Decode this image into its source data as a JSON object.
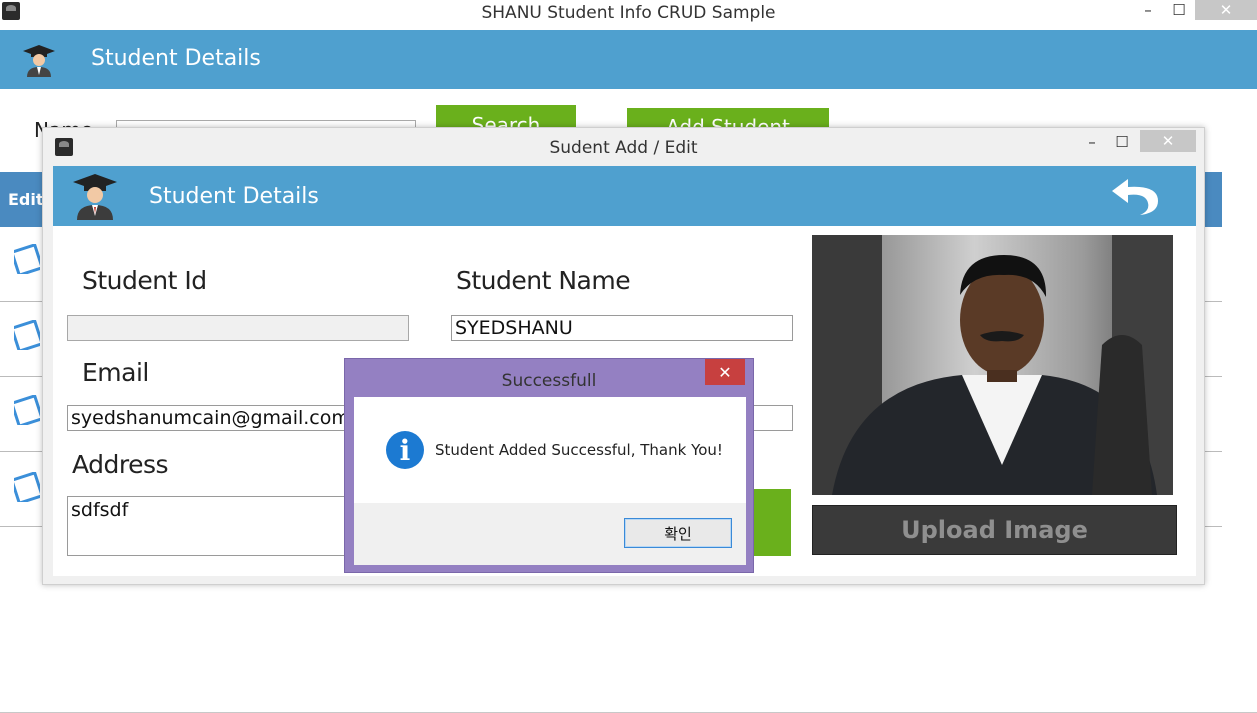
{
  "main_window": {
    "title": "SHANU Student Info CRUD Sample",
    "controls": {
      "minimize": "–",
      "maximize": "☐",
      "close": "✕"
    },
    "header": {
      "title": "Student Details"
    },
    "search": {
      "label": "Name",
      "input_value": "",
      "search_button": "Search",
      "add_button": "Add Student"
    },
    "grid": {
      "columns": [
        "Edit"
      ]
    }
  },
  "edit_window": {
    "title": "Sudent Add /  Edit",
    "controls": {
      "minimize": "–",
      "maximize": "☐",
      "close": "✕"
    },
    "header": {
      "title": "Student Details"
    },
    "fields": {
      "student_id_label": "Student Id",
      "student_id_value": "",
      "student_name_label": "Student Name",
      "student_name_value": "SYEDSHANU",
      "email_label": "Email",
      "email_value": "syedshanumcain@gmail.com",
      "address_label": "Address",
      "address_value": "sdfsdf",
      "phone_value": ""
    },
    "upload_button": "Upload Image"
  },
  "message_box": {
    "title": "Successfull",
    "message": "Student Added Successful, Thank You!",
    "ok_button": "확인",
    "close": "✕"
  },
  "colors": {
    "header_blue": "#4fa0cf",
    "grid_header_blue": "#4a8ac0",
    "green": "#6ab01c",
    "msgbox_purple": "#9480c2",
    "close_red": "#c7403f",
    "info_blue": "#1c7ad2"
  },
  "icons": [
    "graduate-icon",
    "back-arrow-icon",
    "info-icon",
    "edit-icon",
    "app-icon"
  ]
}
